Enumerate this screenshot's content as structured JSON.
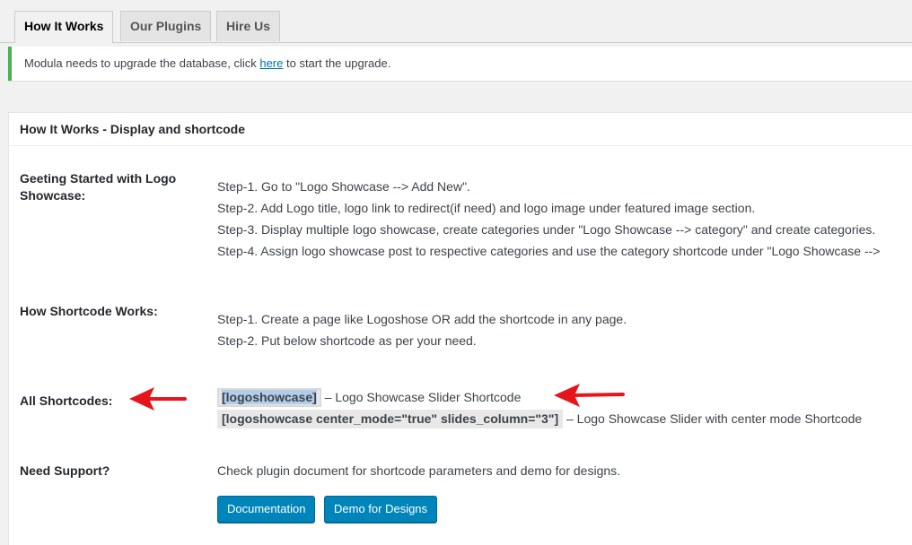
{
  "tabs": [
    {
      "label": "How It Works",
      "active": true
    },
    {
      "label": "Our Plugins",
      "active": false
    },
    {
      "label": "Hire Us",
      "active": false
    }
  ],
  "notice": {
    "before": "Modula needs to upgrade the database, click ",
    "link": "here",
    "after": " to start the upgrade.",
    "accent_color": "#46b450"
  },
  "panel": {
    "title": "How It Works - Display and shortcode",
    "getting_started": {
      "label": "Geeting Started with Logo Showcase:",
      "steps": [
        "Step-1. Go to \"Logo Showcase --> Add New\".",
        "Step-2. Add Logo title, logo link to redirect(if need) and logo image under featured image section.",
        "Step-3. Display multiple logo showcase, create categories under \"Logo Showcase --> category\" and create categories.",
        "Step-4. Assign logo showcase post to respective categories and use the category shortcode under \"Logo Showcase -->"
      ]
    },
    "how_shortcode": {
      "label": "How Shortcode Works:",
      "steps": [
        "Step-1. Create a page like Logoshose OR add the shortcode in any page.",
        "Step-2. Put below shortcode as per your need."
      ]
    },
    "all_shortcodes": {
      "label": "All Shortcodes:",
      "items": [
        {
          "code": "[logoshowcase]",
          "desc": " – Logo Showcase Slider Shortcode"
        },
        {
          "code": "[logoshowcase center_mode=\"true\" slides_column=\"3\"]",
          "desc": " – Logo Showcase Slider with center mode Shortcode"
        }
      ]
    },
    "support": {
      "label": "Need Support?",
      "text": "Check plugin document for shortcode parameters and demo for designs.",
      "buttons": [
        "Documentation",
        "Demo for Designs"
      ]
    }
  },
  "colors": {
    "button": "#0085ba",
    "arrow": "#e8141b",
    "selection": "#b3cde9"
  }
}
